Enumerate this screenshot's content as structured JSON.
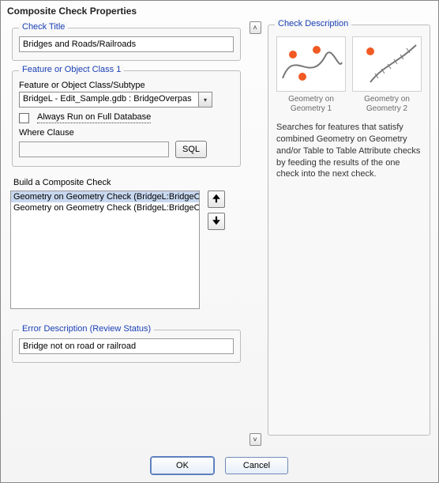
{
  "window": {
    "title": "Composite Check Properties"
  },
  "check_title": {
    "legend": "Check Title",
    "value": "Bridges and Roads/Railroads"
  },
  "feature_class": {
    "legend": "Feature or Object Class 1",
    "label": "Feature or Object Class/Subtype",
    "selected": "BridgeL -  Edit_Sample.gdb : BridgeOverpas",
    "always_run_label": "Always Run on Full Database",
    "always_run_checked": false,
    "where_label": "Where Clause",
    "where_value": "",
    "sql_label": "SQL"
  },
  "composite": {
    "label": "Build a Composite Check",
    "items": [
      "Geometry on Geometry Check (BridgeL:BridgeOver",
      "Geometry on Geometry Check (BridgeL:BridgeOver"
    ],
    "selected_index": 0
  },
  "error_desc": {
    "legend": "Error Description (Review Status)",
    "value": "Bridge not on road or railroad"
  },
  "description": {
    "legend": "Check Description",
    "thumbs": [
      {
        "caption": "Geometry on Geometry 1"
      },
      {
        "caption": "Geometry on Geometry 2"
      }
    ],
    "text": "Searches for features that satisfy combined Geometry on Geometry and/or Table to Table Attribute checks by feeding the results of the one check into the next check."
  },
  "buttons": {
    "ok": "OK",
    "cancel": "Cancel"
  }
}
